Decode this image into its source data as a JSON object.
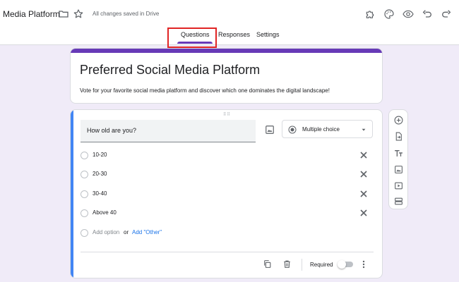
{
  "header": {
    "doc_title": "Media Platform",
    "saved_status": "All changes saved in Drive",
    "icons": [
      "folder-icon",
      "star-icon",
      "addon-icon",
      "palette-icon",
      "preview-eye-icon",
      "undo-icon",
      "redo-icon"
    ]
  },
  "tabs": [
    {
      "label": "Questions",
      "selected": true
    },
    {
      "label": "Responses",
      "selected": false
    },
    {
      "label": "Settings",
      "selected": false
    }
  ],
  "colors": {
    "accent": "#673ab7",
    "background": "#f0ebf8",
    "active_question_bar": "#4285f4",
    "link": "#1a73e8",
    "highlight_box": "#e02424"
  },
  "form": {
    "title": "Preferred Social Media Platform",
    "description": "Vote for your favorite social media platform and discover which one dominates the digital landscape!"
  },
  "question": {
    "text": "How old are you?",
    "type": "Multiple choice",
    "options": [
      "10-20",
      "20-30",
      "30-40",
      "Above 40"
    ],
    "add_option": "Add option",
    "or": "or",
    "add_other": "Add \"Other\"",
    "required_label": "Required",
    "required": false
  },
  "toolbar": {
    "items": [
      "add-question-icon",
      "import-questions-icon",
      "add-title-icon",
      "add-image-icon",
      "add-video-icon",
      "add-section-icon"
    ]
  }
}
